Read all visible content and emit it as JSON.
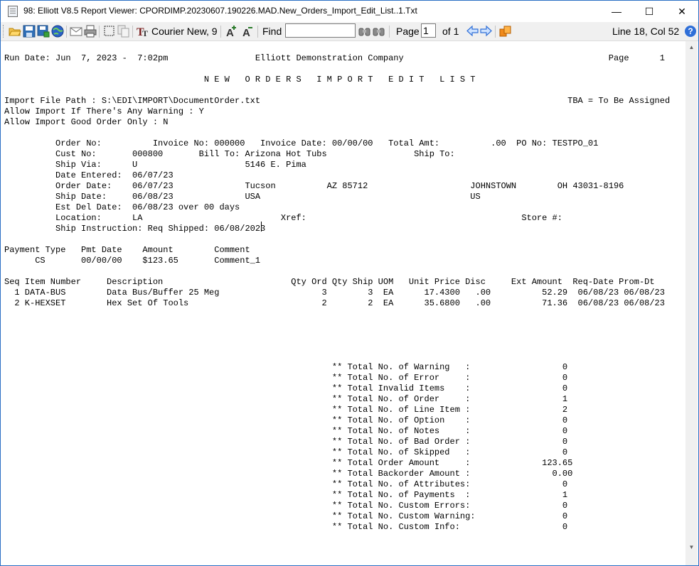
{
  "window": {
    "title": "98: Elliott V8.5 Report Viewer: CPORDIMP.20230607.190226.MAD.New_Orders_Import_Edit_List..1.Txt",
    "minimize": "—",
    "maximize": "☐",
    "close": "✕"
  },
  "toolbar": {
    "font_label": "Courier New, 9",
    "find_label": "Find",
    "find_value": "",
    "page_label": "Page",
    "page_value": "1",
    "page_of": "of 1",
    "status": "Line 18, Col 52",
    "help": "?"
  },
  "report": {
    "lines": [
      "Run Date: Jun  7, 2023 -  7:02pm                 Elliott Demonstration Company                                        Page      1",
      "",
      "                                       N E W   O R D E R S   I M P O R T   E D I T   L I S T",
      "",
      "Import File Path : S:\\EDI\\IMPORT\\DocumentOrder.txt                                                            TBA = To Be Assigned",
      "Allow Import If There's Any Warning : Y",
      "Allow Import Good Order Only : N",
      "",
      "          Order No:          Invoice No: 000000   Invoice Date: 00/00/00   Total Amt:          .00  PO No: TESTPO_01",
      "          Cust No:       000800       Bill To: Arizona Hot Tubs                 Ship To:",
      "          Ship Via:      U                     5146 E. Pima",
      "          Date Entered:  06/07/23",
      "          Order Date:    06/07/23              Tucson          AZ 85712                    JOHNSTOWN        OH 43031-8196",
      "          Ship Date:     06/08/23              USA                                         US",
      "          Est Del Date:  06/08/23 over 00 days",
      "          Location:      LA                           Xref:                                          Store #:",
      "          Ship Instruction: Req Shipped: 06/08/2023",
      "",
      "Payment Type   Pmt Date    Amount        Comment",
      "      CS       00/00/00    $123.65       Comment_1",
      "",
      "Seq Item Number     Description                         Qty Ord Qty Ship UOM   Unit Price Disc     Ext Amount  Req-Date Prom-Dt",
      "  1 DATA-BUS        Data Bus/Buffer 25 Meg                    3        3  EA      17.4300   .00          52.29  06/08/23 06/08/23",
      "  2 K-HEXSET        Hex Set Of Tools                          2        2  EA      35.6800   .00          71.36  06/08/23 06/08/23",
      "",
      "",
      "",
      "",
      "",
      "                                                                ** Total No. of Warning   :                  0",
      "                                                                ** Total No. of Error     :                  0",
      "                                                                ** Total Invalid Items    :                  0",
      "                                                                ** Total No. of Order     :                  1",
      "                                                                ** Total No. of Line Item :                  2",
      "                                                                ** Total No. of Option    :                  0",
      "                                                                ** Total No. of Notes     :                  0",
      "                                                                ** Total No. of Bad Order :                  0",
      "                                                                ** Total No. of Skipped   :                  0",
      "                                                                ** Total Order Amount     :              123.65",
      "                                                                ** Total Backorder Amount :                0.00",
      "                                                                ** Total No. of Attributes:                  0",
      "                                                                ** Total No. of Payments  :                  1",
      "                                                                ** Total No. Custom Errors:                  0",
      "                                                                ** Total No. Custom Warning:                 0",
      "                                                                ** Total No. Custom Info:                    0"
    ]
  },
  "icons": [
    "open-folder-icon",
    "save-icon",
    "save-as-icon",
    "web-icon",
    "email-icon",
    "print-icon",
    "select-icon",
    "copy-icon",
    "font-icon",
    "font-larger-icon",
    "font-smaller-icon",
    "find-prev-icon",
    "find-next-icon",
    "arrow-left-icon",
    "arrow-right-icon",
    "export-icon",
    "help-icon"
  ]
}
